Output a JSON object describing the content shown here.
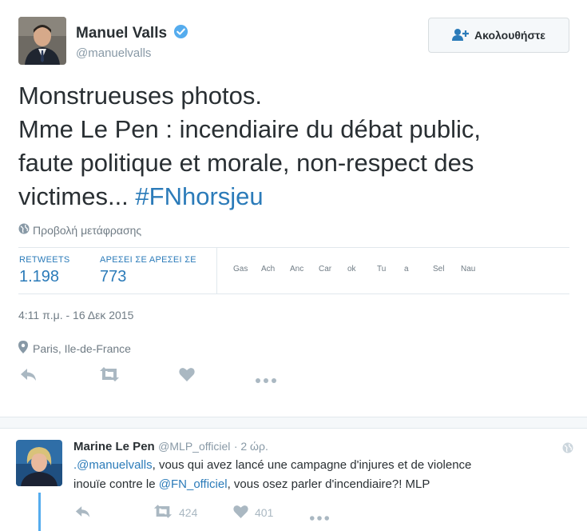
{
  "tweet": {
    "author_name": "Manuel Valls",
    "author_handle": "@manuelvalls",
    "follow_label": "Ακολουθήστε",
    "text_line1": "Monstrueuses photos.",
    "text_line2": "Mme Le Pen : incendiaire du débat public,",
    "text_line3": "faute politique et morale, non-respect des",
    "text_line4_prefix": "victimes... ",
    "hashtag": "#FNhorsjeu",
    "translate_label": "Προβολή μετάφρασης",
    "retweets_label": "RETWEETS",
    "retweets_count": "1.198",
    "likes_label": "ΑΡΕΣΕΙ ΣΕ ΑΡΕΣΕΙ ΣΕ",
    "likes_count": "773",
    "likers": [
      "Gas",
      "Ach",
      "Anc",
      "Car",
      "ok",
      "Tu",
      "a",
      "Sel",
      "Nau"
    ],
    "timestamp": "4:11 π.μ. - 16 Δεκ 2015",
    "location": "Paris, Ile-de-France"
  },
  "reply": {
    "author_name": "Marine Le Pen",
    "author_handle": "@MLP_officiel",
    "time": "· 2 ώρ.",
    "mention1": ".@manuelvalls",
    "text1": ", vous qui avez lancé une campagne d'injures et de violence",
    "text2": "inouïe contre le ",
    "mention2": "@FN_officiel",
    "text3": ", vous osez parler d'incendiaire?! MLP",
    "retweet_count": "424",
    "like_count": "401"
  },
  "colors": {
    "link": "#2b7bb9",
    "verified": "#55acee",
    "muted": "#aab8c2"
  }
}
